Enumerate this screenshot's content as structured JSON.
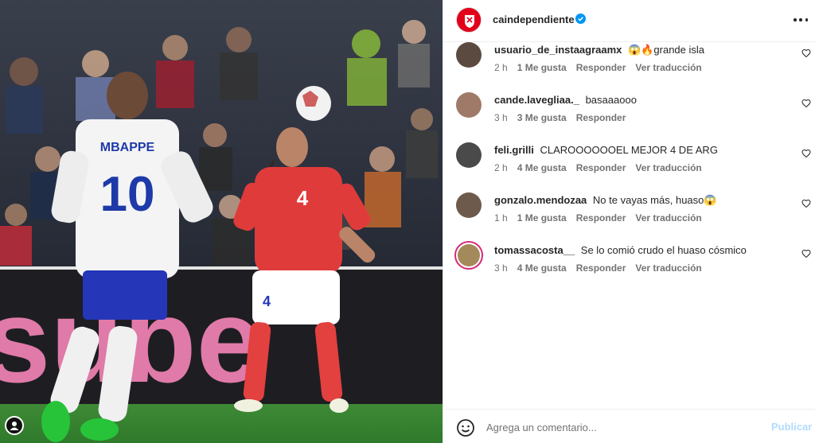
{
  "post": {
    "username": "caindependiente",
    "verified": true,
    "more_icon": "more-horizontal-icon"
  },
  "photo": {
    "player_left_name": "MBAPPE",
    "player_left_number": "10",
    "player_right_number": "4",
    "player_right_short_number": "4",
    "ad_board_text": "sube"
  },
  "comments": [
    {
      "user": "usuario_de_instaagraamx",
      "text": "😱🔥grande isla",
      "time": "2 h",
      "likes": "1 Me gusta",
      "reply": "Responder",
      "translate": "Ver traducción"
    },
    {
      "user": "cande.lavegliaa._",
      "text": "basaaaooo",
      "time": "3 h",
      "likes": "3 Me gusta",
      "reply": "Responder",
      "translate": ""
    },
    {
      "user": "feli.grilli",
      "text": "CLAROOOOOOEL MEJOR 4 DE ARG",
      "time": "2 h",
      "likes": "4 Me gusta",
      "reply": "Responder",
      "translate": "Ver traducción"
    },
    {
      "user": "gonzalo.mendozaa",
      "text": "No te vayas más, huaso😱",
      "time": "1 h",
      "likes": "1 Me gusta",
      "reply": "Responder",
      "translate": "Ver traducción"
    },
    {
      "user": "tomassacosta__",
      "text": "Se lo comió crudo el huaso cósmico",
      "time": "3 h",
      "likes": "4 Me gusta",
      "reply": "Responder",
      "translate": "Ver traducción"
    }
  ],
  "footer": {
    "placeholder": "Agrega un comentario...",
    "publish": "Publicar",
    "emoji_icon": "emoji-icon"
  },
  "colors": {
    "verified": "#0095f6",
    "publish_disabled": "#b3dbff",
    "brand_red": "#e2001a"
  }
}
